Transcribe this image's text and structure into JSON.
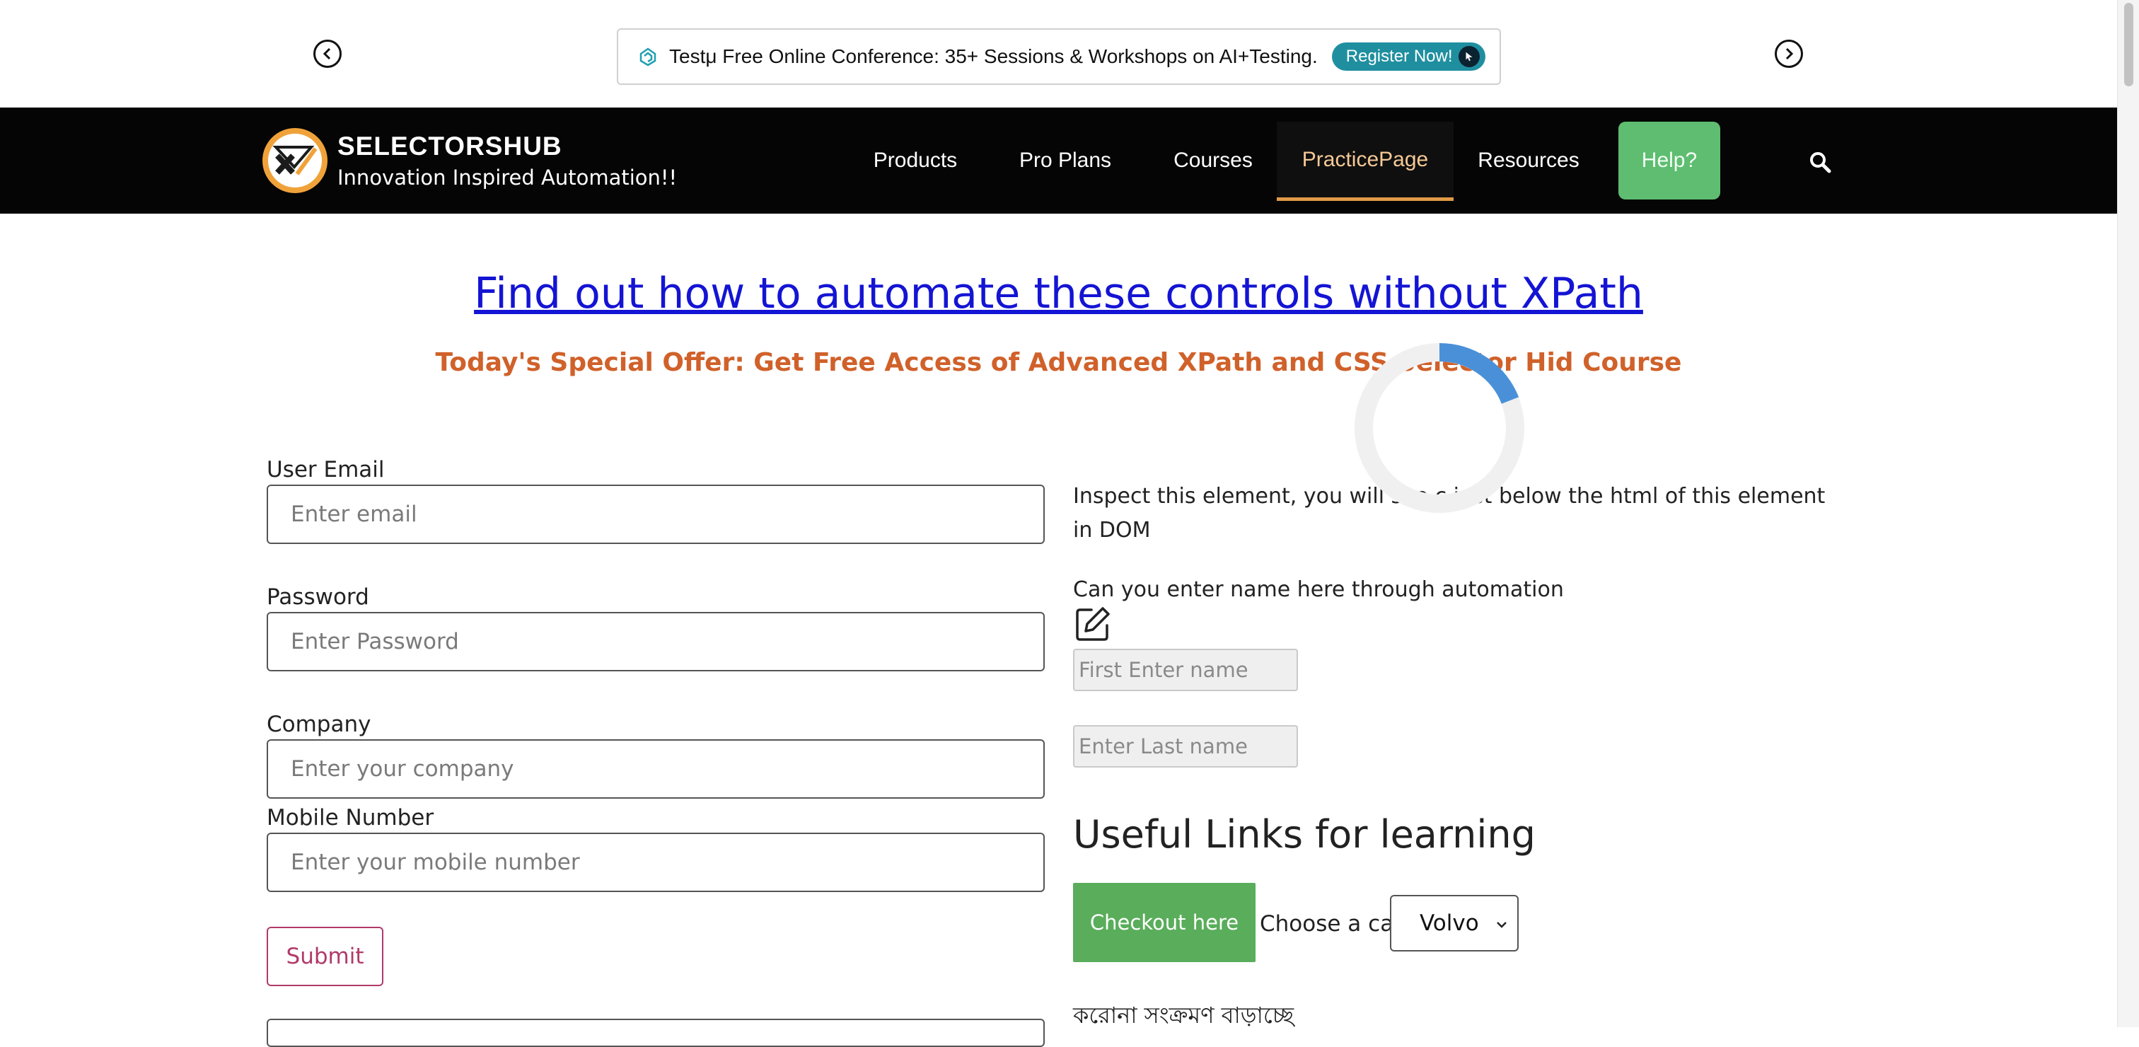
{
  "announcement": {
    "text": "Testμ Free Online Conference: 35+ Sessions & Workshops on AI+Testing.",
    "cta_label": "Register Now!"
  },
  "navbar": {
    "brand_name": "SELECTORSHUB",
    "brand_tagline": "Innovation Inspired Automation!!",
    "items": [
      {
        "label": "Products"
      },
      {
        "label": "Pro Plans"
      },
      {
        "label": "Courses"
      },
      {
        "label": "PracticePage",
        "active": true
      },
      {
        "label": "Resources"
      },
      {
        "label": "Help?"
      }
    ],
    "active_color": "#e09a46",
    "help_color": "#5ebd71"
  },
  "main": {
    "heading_link": "Find out how to automate these controls without XPath",
    "offer": "Today's Special Offer: Get Free Access of Advanced XPath and CSS Selector Hid Course",
    "loading_spinner": true
  },
  "form": {
    "email_label": "User Email",
    "email_placeholder": "Enter email",
    "password_label": "Password",
    "password_placeholder": "Enter Password",
    "company_label": "Company",
    "company_placeholder": "Enter your company",
    "mobile_label": "Mobile Number",
    "mobile_placeholder": "Enter your mobile number",
    "submit_label": "Submit"
  },
  "right": {
    "inspect_text": "Inspect this element, you will see c        just below the html of this element in DOM",
    "can_enter_text": "Can you enter name here through automation",
    "first_name_placeholder": "First Enter name",
    "last_name_placeholder": "Enter Last name",
    "useful_links_heading": "Useful Links for learning",
    "checkout_label": "Checkout here",
    "car_label": "Choose a car:",
    "car_selected": "Volvo",
    "bengali_text": "করোনা সংক্রমণ বাড়াচ্ছে"
  },
  "colors": {
    "navbar_bg": "#050505",
    "link": "#1414d4",
    "offer": "#d0612a",
    "checkout_button": "#5aad5b",
    "submit_border": "#b13a6a"
  }
}
